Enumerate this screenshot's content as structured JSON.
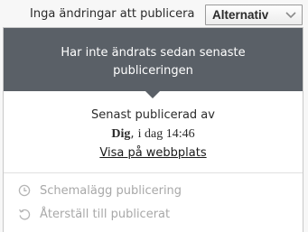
{
  "header": {
    "status_text": "Inga ändringar att publicera",
    "options_label": "Alternativ"
  },
  "panel": {
    "notice_line1": "Har inte ändrats sedan senaste",
    "notice_line2": "publiceringen",
    "last_published_label": "Senast publicerad av",
    "published_by": "Dig",
    "published_sep": ",",
    "published_time": "i dag 14:46",
    "view_link": "Visa på webbplats"
  },
  "menu": {
    "items": [
      {
        "label": "Schemalägg publicering",
        "icon": "clock-icon",
        "enabled": false
      },
      {
        "label": "Återställ till publicerat",
        "icon": "revert-icon",
        "enabled": false
      }
    ]
  },
  "colors": {
    "header_bg": "#5a6067",
    "disabled_text": "#a8a8a8"
  }
}
